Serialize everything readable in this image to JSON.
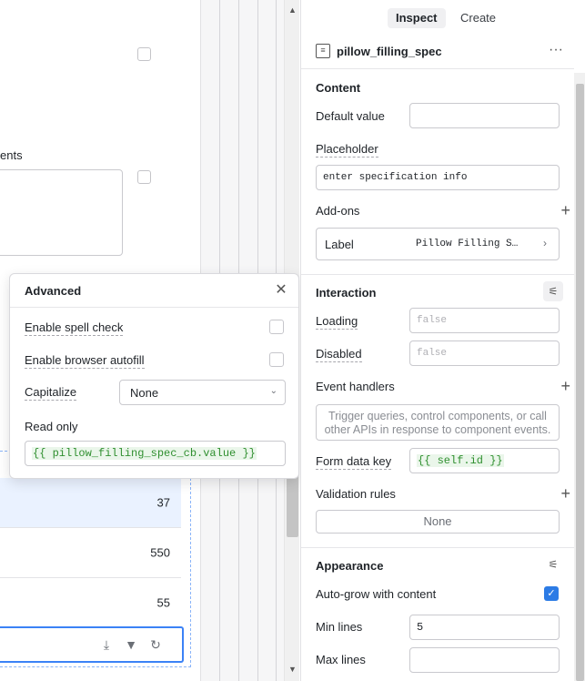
{
  "canvas": {
    "partial_label": "ents",
    "table_values": [
      "37",
      "550",
      "55"
    ],
    "toolbar_icons": [
      "download-icon",
      "filter-icon",
      "refresh-icon"
    ]
  },
  "popover": {
    "title": "Advanced",
    "spell_check_label": "Enable spell check",
    "autofill_label": "Enable browser autofill",
    "capitalize_label": "Capitalize",
    "capitalize_value": "None",
    "readonly_label": "Read only",
    "readonly_value": "{{ pillow_filling_spec_cb.value }}"
  },
  "inspector": {
    "tabs": [
      "Inspect",
      "Create"
    ],
    "active_tab": "Inspect",
    "component_name": "pillow_filling_spec",
    "content": {
      "title": "Content",
      "default_value_label": "Default value",
      "default_value": "",
      "placeholder_label": "Placeholder",
      "placeholder_value": "enter specification info",
      "addons_label": "Add-ons",
      "addon_label": "Label",
      "addon_value": "Pillow Filling S…"
    },
    "interaction": {
      "title": "Interaction",
      "loading_label": "Loading",
      "loading_placeholder": "false",
      "disabled_label": "Disabled",
      "disabled_placeholder": "false",
      "event_handlers_label": "Event handlers",
      "event_hint": "Trigger queries, control components, or call other APIs in response to component events.",
      "form_key_label": "Form data key",
      "form_key_value": "{{ self.id }}",
      "validation_label": "Validation rules",
      "validation_value": "None"
    },
    "appearance": {
      "title": "Appearance",
      "autogrow_label": "Auto-grow with content",
      "autogrow_checked": true,
      "min_lines_label": "Min lines",
      "min_lines_value": "5",
      "max_lines_label": "Max lines",
      "max_lines_value": ""
    }
  },
  "colors": {
    "accent": "#2c7be5",
    "code_green": "#2f8f2f",
    "selection_bg": "#eaf2ff"
  }
}
